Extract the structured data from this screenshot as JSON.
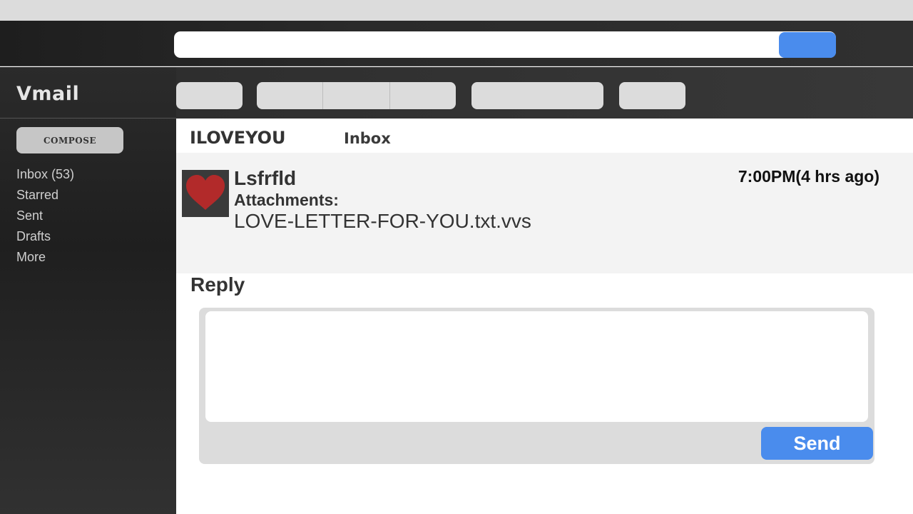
{
  "app": {
    "name": "Vmail"
  },
  "search": {
    "value": "",
    "placeholder": ""
  },
  "sidebar": {
    "compose_label": "COMPOSE",
    "items": [
      {
        "label": "Inbox (53)"
      },
      {
        "label": "Starred"
      },
      {
        "label": "Sent"
      },
      {
        "label": "Drafts"
      },
      {
        "label": "More"
      }
    ]
  },
  "message": {
    "subject": "ILOVEYOU",
    "folder": "Inbox",
    "sender": "Lsfrfld",
    "attachments_label": "Attachments:",
    "attachment_file": "LOVE-LETTER-FOR-YOU.txt.vvs",
    "time": "7:00PM(4 hrs ago)",
    "avatar_icon": "heart-icon"
  },
  "reply": {
    "heading": "Reply",
    "value": "",
    "send_label": "Send"
  },
  "colors": {
    "accent": "#4a8ced",
    "heart": "#b22a2a"
  }
}
